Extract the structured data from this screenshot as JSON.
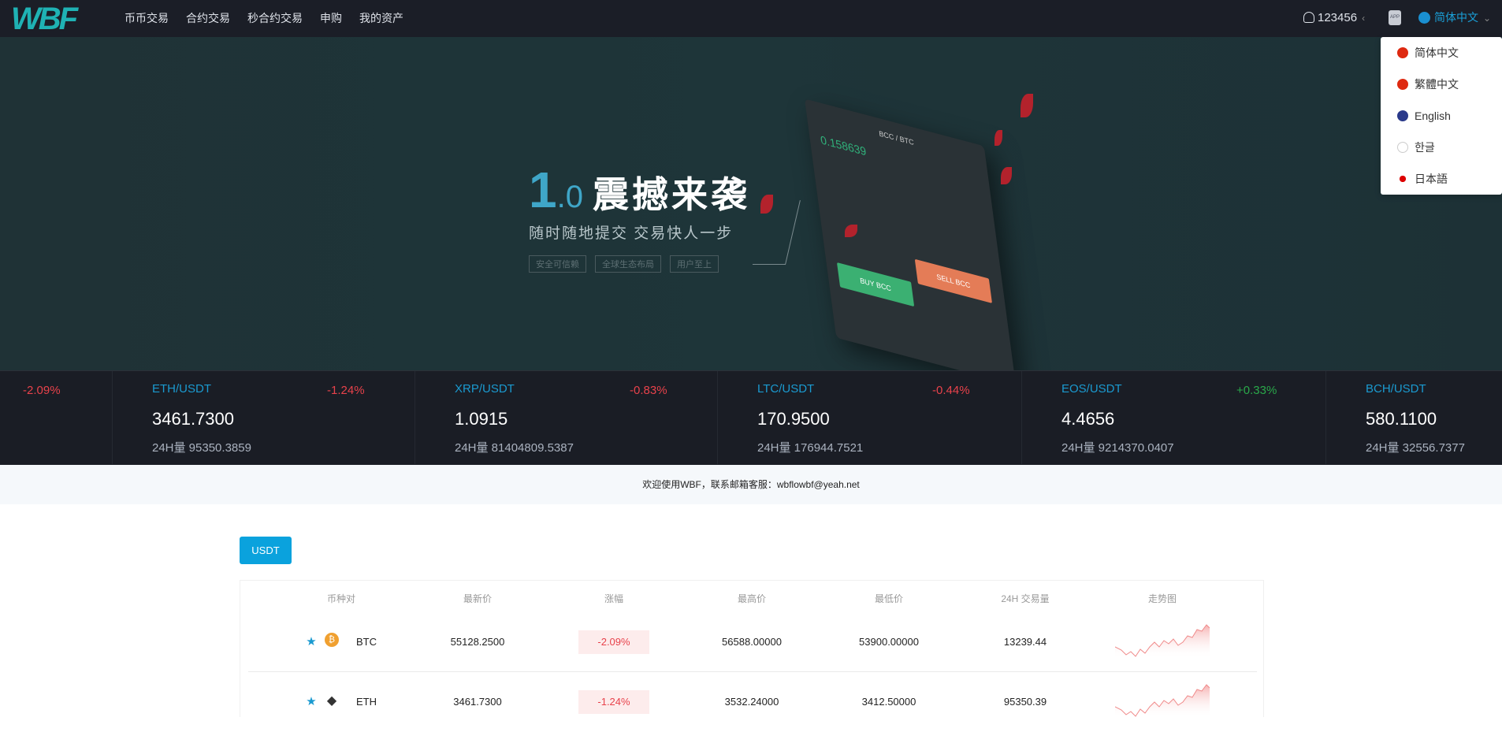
{
  "nav": {
    "logo": "WBF",
    "menu": [
      "币币交易",
      "合约交易",
      "秒合约交易",
      "申购",
      "我的资产"
    ],
    "user": "123456",
    "app_label": "APP",
    "language": "简体中文"
  },
  "language_menu": [
    {
      "label": "简体中文",
      "flag": "cn"
    },
    {
      "label": "繁體中文",
      "flag": "cn"
    },
    {
      "label": "English",
      "flag": "uk"
    },
    {
      "label": "한글",
      "flag": "kr"
    },
    {
      "label": "日本語",
      "flag": "jp"
    }
  ],
  "banner": {
    "one": "1",
    "point_zero": ".0",
    "title": "震撼来袭",
    "subtitle": "随时随地提交  交易快人一步",
    "tags": [
      "安全可信赖",
      "全球生态布局",
      "用户至上"
    ],
    "phone_pair": "BCC / BTC",
    "phone_price": "0.158639",
    "phone_buy": "BUY BCC",
    "phone_sell": "SELL BCC"
  },
  "ticker": [
    {
      "pair": "",
      "change": "-2.09%",
      "price": "",
      "volume": ""
    },
    {
      "pair": "ETH/USDT",
      "change": "-1.24%",
      "price": "3461.7300",
      "volume": "24H量 95350.3859"
    },
    {
      "pair": "XRP/USDT",
      "change": "-0.83%",
      "price": "1.0915",
      "volume": "24H量 81404809.5387"
    },
    {
      "pair": "LTC/USDT",
      "change": "-0.44%",
      "price": "170.9500",
      "volume": "24H量 176944.7521"
    },
    {
      "pair": "EOS/USDT",
      "change": "+0.33%",
      "price": "4.4656",
      "volume": "24H量 9214370.0407"
    },
    {
      "pair": "BCH/USDT",
      "change": "",
      "price": "580.1100",
      "volume": "24H量 32556.7377"
    }
  ],
  "colors": {
    "up": "#2aa84a",
    "down": "#e8424b",
    "accent": "#0aa2dd"
  },
  "notice": "欢迎使用WBF，联系邮箱客服：wbflowbf@yeah.net",
  "market": {
    "tab": "USDT",
    "headers": [
      "币种对",
      "最新价",
      "涨幅",
      "最高价",
      "最低价",
      "24H 交易量",
      "走势图"
    ],
    "rows": [
      {
        "coin": "BTC",
        "icon": "bitcoin-icon",
        "price": "55128.2500",
        "change": "-2.09%",
        "high": "56588.00000",
        "low": "53900.00000",
        "volume": "13239.44"
      },
      {
        "coin": "ETH",
        "icon": "ethereum-icon",
        "price": "3461.7300",
        "change": "-1.24%",
        "high": "3532.24000",
        "low": "3412.50000",
        "volume": "95350.39"
      }
    ]
  }
}
